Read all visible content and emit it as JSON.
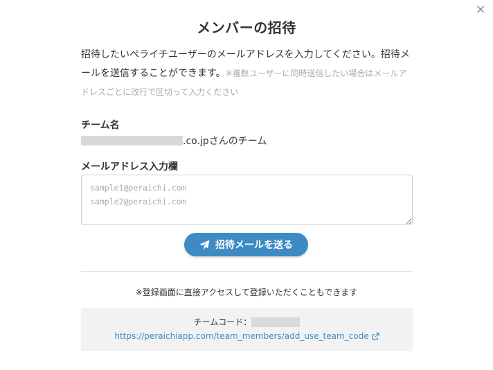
{
  "modal": {
    "close_label": "×",
    "title": "メンバーの招待",
    "description": "招待したいペライチユーザーのメールアドレスを入力してください。招待メールを送信することができます。",
    "description_note": "※複数ユーザーに同時送信したい場合はメールアドレスごとに改行で区切って入力ください"
  },
  "team": {
    "label": "チーム名",
    "name_suffix": ".co.jpさんのチーム"
  },
  "email_input": {
    "label": "メールアドレス入力欄",
    "placeholder": "sample1@peraichi.com\nsample2@peraichi.com",
    "value": ""
  },
  "send_button": {
    "label": "招待メールを送る",
    "icon": "paper-plane-icon"
  },
  "direct_access": {
    "note": "※登録画面に直接アクセスして登録いただくこともできます",
    "team_code_label": "チームコード：",
    "link": "https://peraichiapp.com/team_members/add_use_team_code",
    "link_icon": "external-link-icon"
  },
  "colors": {
    "accent": "#3e8bc4",
    "note_gray": "#aaaaaa",
    "panel_bg": "#f2f2f2",
    "redacted": "#d9d9d9"
  }
}
